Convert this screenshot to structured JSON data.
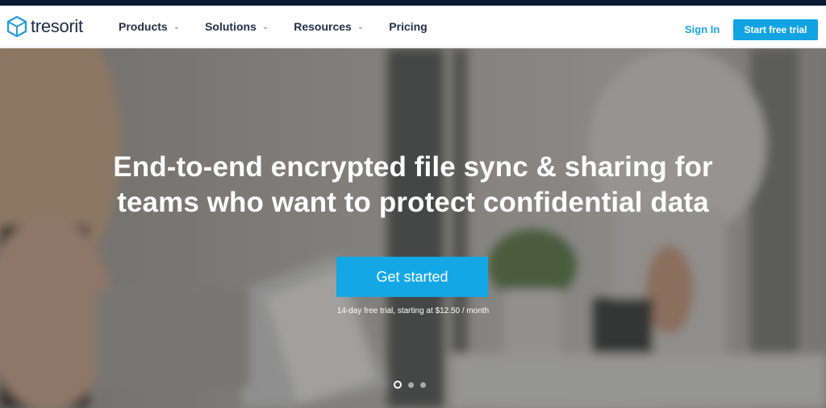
{
  "brand": {
    "name": "tresorit",
    "accent": "#14a7e6",
    "dark": "#0b1a33"
  },
  "nav": {
    "items": [
      {
        "label": "Products",
        "icon": "chevron-down-icon"
      },
      {
        "label": "Solutions",
        "icon": "chevron-down-icon"
      },
      {
        "label": "Resources",
        "icon": "chevron-down-icon"
      },
      {
        "label": "Pricing"
      }
    ],
    "chevron": "⌄",
    "sign_in": "Sign In",
    "trial_button": "Start free trial"
  },
  "hero": {
    "headline_line1": "End-to-end encrypted file sync & sharing for",
    "headline_line2": "teams who want to protect confidential data",
    "cta": "Get started",
    "subtext": "14-day free trial, starting at $12.50 / month",
    "slides": {
      "count": 3,
      "active": 1
    }
  }
}
